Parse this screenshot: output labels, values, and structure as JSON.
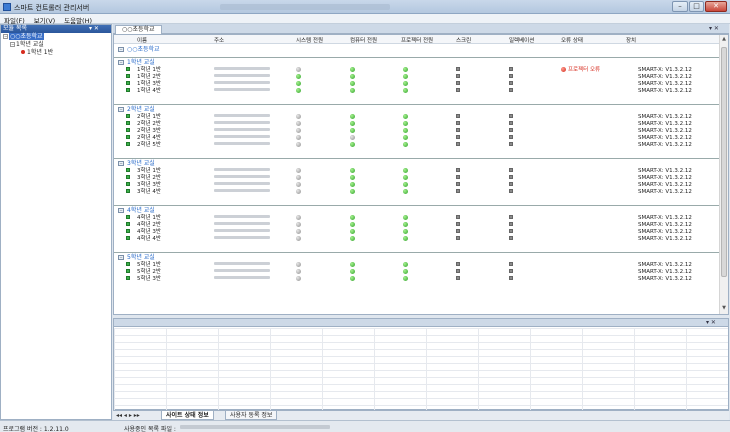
{
  "window": {
    "title": "스마트 컨트롤러 관리서버",
    "min": "–",
    "max": "□",
    "close": "✕"
  },
  "menu": [
    "파일(F)",
    "보기(V)",
    "도움말(H)"
  ],
  "left_panel": {
    "title": "모듈 목록",
    "ctrl": "▾ ✕",
    "tree": {
      "root": "○○초등학교",
      "child": "1학년 교실",
      "leaf": "1학년 1반"
    }
  },
  "doc": {
    "tab": "○○초등학교",
    "ctrl": "▾ ✕"
  },
  "columns": [
    "이름",
    "주소",
    "시스템 전원",
    "컴퓨터 전원",
    "프로젝터 전원",
    "스크린",
    "일렉베이션",
    "오류 상태",
    "장치"
  ],
  "school_group": "○○초등학교",
  "device_version": "SMART-X: V1.3.2.12",
  "error_text": "프로젝터 오류",
  "groups": [
    {
      "label": "1학년 교실",
      "rows": [
        {
          "name": "1학년 1반",
          "sys": "gr",
          "pc": "g",
          "proj": "g",
          "err": true
        },
        {
          "name": "1학년 2반",
          "sys": "g",
          "pc": "g",
          "proj": "g",
          "err": false
        },
        {
          "name": "1학년 3반",
          "sys": "g",
          "pc": "g",
          "proj": "g",
          "err": false
        },
        {
          "name": "1학년 4반",
          "sys": "g",
          "pc": "g",
          "proj": "g",
          "err": false
        }
      ]
    },
    {
      "label": "2학년 교실",
      "rows": [
        {
          "name": "2학년 1반",
          "sys": "gr",
          "pc": "g",
          "proj": "g",
          "err": false
        },
        {
          "name": "2학년 2반",
          "sys": "gr",
          "pc": "g",
          "proj": "g",
          "err": false
        },
        {
          "name": "2학년 3반",
          "sys": "gr",
          "pc": "g",
          "proj": "g",
          "err": false
        },
        {
          "name": "2학년 4반",
          "sys": "gr",
          "pc": "gr",
          "proj": "g",
          "err": false
        },
        {
          "name": "2학년 5반",
          "sys": "gr",
          "pc": "g",
          "proj": "g",
          "err": false
        }
      ]
    },
    {
      "label": "3학년 교실",
      "rows": [
        {
          "name": "3학년 1반",
          "sys": "gr",
          "pc": "g",
          "proj": "g",
          "err": false
        },
        {
          "name": "3학년 2반",
          "sys": "gr",
          "pc": "g",
          "proj": "g",
          "err": false
        },
        {
          "name": "3학년 3반",
          "sys": "gr",
          "pc": "g",
          "proj": "g",
          "err": false
        },
        {
          "name": "3학년 4반",
          "sys": "gr",
          "pc": "g",
          "proj": "g",
          "err": false
        }
      ]
    },
    {
      "label": "4학년 교실",
      "rows": [
        {
          "name": "4학년 1반",
          "sys": "gr",
          "pc": "g",
          "proj": "g",
          "err": false
        },
        {
          "name": "4학년 2반",
          "sys": "gr",
          "pc": "g",
          "proj": "g",
          "err": false
        },
        {
          "name": "4학년 3반",
          "sys": "gr",
          "pc": "g",
          "proj": "g",
          "err": false
        },
        {
          "name": "4학년 4반",
          "sys": "gr",
          "pc": "g",
          "proj": "g",
          "err": false
        }
      ]
    },
    {
      "label": "5학년 교실",
      "rows": [
        {
          "name": "5학년 1반",
          "sys": "gr",
          "pc": "g",
          "proj": "g",
          "err": false
        },
        {
          "name": "5학년 2반",
          "sys": "gr",
          "pc": "g",
          "proj": "g",
          "err": false
        },
        {
          "name": "5학년 3반",
          "sys": "gr",
          "pc": "g",
          "proj": "g",
          "err": false
        }
      ]
    }
  ],
  "bottom_panel": {
    "ctrl": "▾ ✕"
  },
  "bottom_tabs": {
    "nav": "◂◂ ◂ ▸ ▸▸",
    "tab1": "사이트 상태 정보",
    "tab2": "사용자 동록 정보"
  },
  "status": {
    "version": "프로그램 버전 : 1.2.11.0",
    "list": "사용중인 목록 파일 :"
  },
  "colors": {
    "accent": "#3a6fc7",
    "error": "#d62b1e",
    "ok": "#3db04a"
  }
}
